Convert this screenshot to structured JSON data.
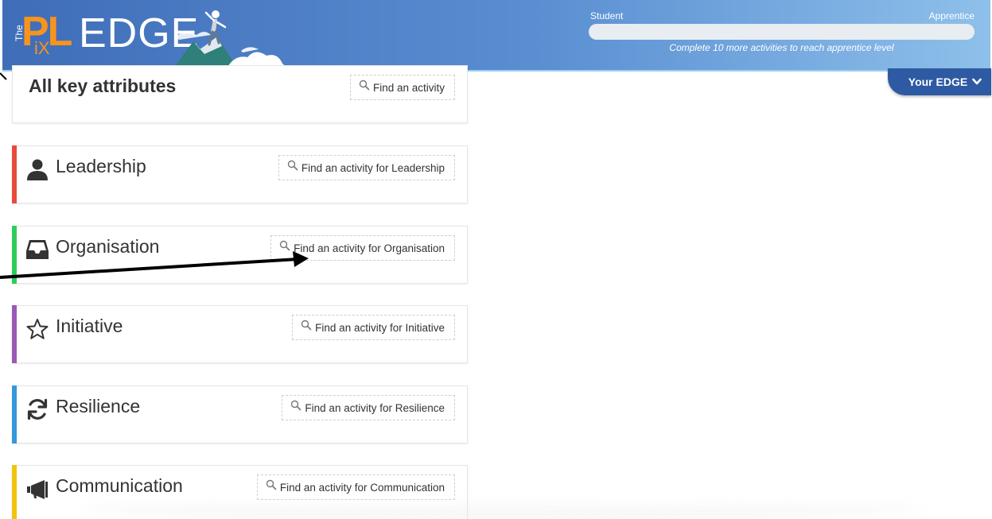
{
  "header": {
    "logo": {
      "the": "The",
      "pl": "PL",
      "ix": "iX",
      "edge": "EDGE"
    },
    "progress": {
      "left_label": "Student",
      "right_label": "Apprentice",
      "fraction": 0.0,
      "note": "Complete 10 more activities to reach apprentice level"
    },
    "your_edge_label": "Your EDGE"
  },
  "cards": [
    {
      "title": "All key attributes",
      "button": "Find an activity",
      "icon": "none",
      "color": ""
    },
    {
      "title": "Leadership",
      "button": "Find an activity for Leadership",
      "icon": "person-icon",
      "color": "#e94b3c"
    },
    {
      "title": "Organisation",
      "button": "Find an activity for Organisation",
      "icon": "inbox-icon",
      "color": "#2ecc5b"
    },
    {
      "title": "Initiative",
      "button": "Find an activity for Initiative",
      "icon": "star-icon",
      "color": "#9b59b6"
    },
    {
      "title": "Resilience",
      "button": "Find an activity for Resilience",
      "icon": "refresh-icon",
      "color": "#3498db"
    },
    {
      "title": "Communication",
      "button": "Find an activity for Communication",
      "icon": "megaphone-icon",
      "color": "#f1c40f"
    }
  ],
  "colors": {
    "header_start": "#3f6db8",
    "header_end": "#8ec0ea",
    "logo_orange": "#f7941d",
    "your_edge_bg": "#2e5aa3"
  }
}
